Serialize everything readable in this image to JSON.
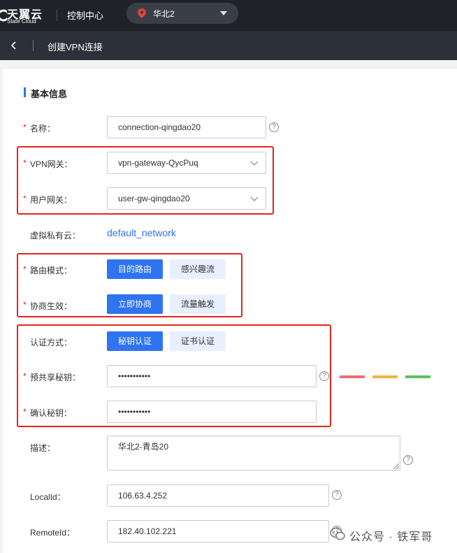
{
  "topbar": {
    "logo_cn": "天翼云",
    "logo_en": "State Cloud",
    "console": "控制中心",
    "region": "华北2"
  },
  "subbar": {
    "title": "创建VPN连接"
  },
  "section": {
    "title": "基本信息"
  },
  "form": {
    "name": {
      "label": "名称：",
      "value": "connection-qingdao20"
    },
    "vpn_gateway": {
      "label": "VPN网关：",
      "value": "vpn-gateway-QycPuq"
    },
    "user_gateway": {
      "label": "用户网关：",
      "value": "user-gw-qingdao20"
    },
    "vpc": {
      "label": "虚拟私有云：",
      "value": "default_network"
    },
    "route_mode": {
      "label": "路由模式：",
      "options": [
        "目的路由",
        "感兴趣流"
      ],
      "selected": 0
    },
    "negotiation": {
      "label": "协商生效：",
      "options": [
        "立即协商",
        "流量触发"
      ],
      "selected": 0
    },
    "auth_method": {
      "label": "认证方式：",
      "options": [
        "秘钥认证",
        "证书认证"
      ],
      "selected": 0
    },
    "psk": {
      "label": "预共享秘钥：",
      "value": "•••••••••••"
    },
    "psk_confirm": {
      "label": "确认秘钥：",
      "value": "•••••••••••"
    },
    "description": {
      "label": "描述：",
      "value": "华北2-青岛20"
    },
    "local_id": {
      "label": "LocalId：",
      "value": "106.63.4.252"
    },
    "remote_id": {
      "label": "RemoteId：",
      "value": "182.40.102.221"
    }
  },
  "required_mark": "*",
  "help_mark": "?",
  "strength_colors": [
    "#eb6f6f",
    "#f0b445",
    "#5cc05c"
  ],
  "accent_color": "#2e73f0",
  "highlight_color": "#e5241c",
  "watermark": {
    "text": "公众号 · 铁军哥"
  }
}
